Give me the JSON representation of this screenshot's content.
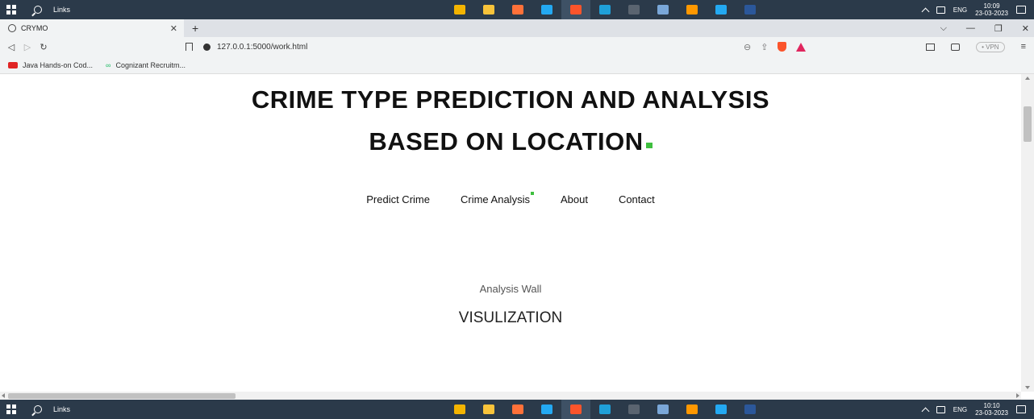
{
  "taskbar_top": {
    "search_label": "Links",
    "apps": [
      {
        "name": "store-icon",
        "color": "#f4b400"
      },
      {
        "name": "file-explorer-icon",
        "color": "#f8c33a"
      },
      {
        "name": "firefox-icon",
        "color": "#ff7139"
      },
      {
        "name": "vscode-icon",
        "color": "#23a9f2"
      },
      {
        "name": "brave-icon",
        "color": "#fb542b"
      },
      {
        "name": "edge-icon",
        "color": "#1fa0d8"
      },
      {
        "name": "terminal-icon",
        "color": "#5a6470"
      },
      {
        "name": "notepad-icon",
        "color": "#7aa7d8"
      },
      {
        "name": "sublime-icon",
        "color": "#ff9800"
      },
      {
        "name": "vscode-icon-2",
        "color": "#23a9f2"
      },
      {
        "name": "word-icon",
        "color": "#2b579a"
      }
    ],
    "lang": "ENG",
    "time": "10:09",
    "date": "23-03-2023"
  },
  "taskbar_bottom": {
    "search_label": "Links",
    "lang": "ENG",
    "time": "10:10",
    "date": "23-03-2023"
  },
  "browser": {
    "tab_title": "CRYMO",
    "url": "127.0.0.1:5000/work.html",
    "vpn_label": "• VPN",
    "bookmarks": [
      "Java Hands-on Cod...",
      "Cognizant Recruitm..."
    ]
  },
  "page": {
    "title_line1": "CRIME TYPE PREDICTION AND ANALYSIS",
    "title_line2": "BASED ON LOCATION",
    "nav": [
      "Predict Crime",
      "Crime Analysis",
      "About",
      "Contact"
    ],
    "subtitle": "Analysis Wall",
    "heading": "VISULIZATION"
  },
  "colors": {
    "accent_green": "#3fbf3f",
    "taskbar": "#2b3a4a"
  }
}
